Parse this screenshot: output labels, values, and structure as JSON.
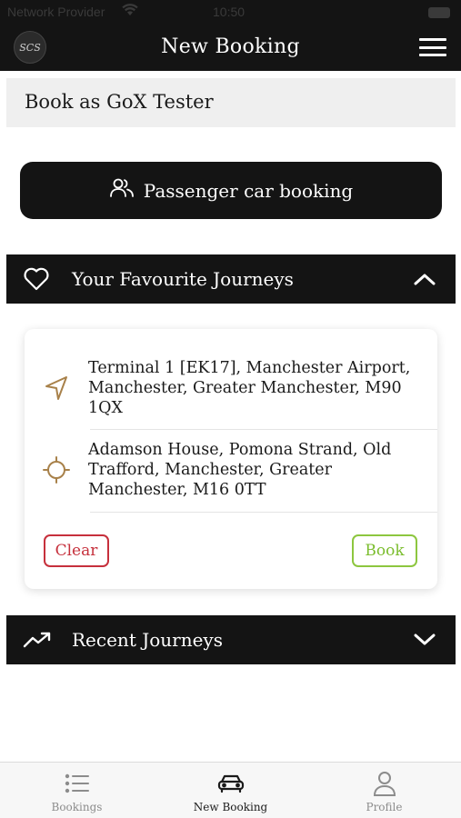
{
  "status_bar": {
    "carrier": "Network Provider",
    "time": "10:50"
  },
  "nav": {
    "logo_text": "SCS",
    "title": "New Booking",
    "menu_icon": "hamburger-icon"
  },
  "book_as": {
    "label": "Book as GoX Tester"
  },
  "passenger_button": {
    "icon": "users-icon",
    "label": "Passenger car booking"
  },
  "favourites": {
    "icon": "heart-icon",
    "label": "Your Favourite Journeys",
    "expanded": true,
    "journeys": [
      {
        "pickup": {
          "icon": "navigation-arrow-icon",
          "address": "Terminal 1 [EK17], Manchester Airport, Manchester, Greater Manchester, M90 1QX"
        },
        "dropoff": {
          "icon": "crosshair-icon",
          "address": "Adamson House, Pomona Strand, Old Trafford, Manchester, Greater Manchester, M16 0TT"
        },
        "clear_label": "Clear",
        "book_label": "Book"
      }
    ]
  },
  "recent": {
    "icon": "trending-up-icon",
    "label": "Recent Journeys",
    "expanded": false
  },
  "tabs": [
    {
      "label": "Bookings",
      "icon": "list-icon",
      "active": false
    },
    {
      "label": "New Booking",
      "icon": "car-icon",
      "active": true
    },
    {
      "label": "Profile",
      "icon": "user-icon",
      "active": false
    }
  ],
  "colors": {
    "header_bg": "#141414",
    "accent_gold": "#a8814a",
    "clear_red": "#c6303c",
    "book_green": "#8dc63f"
  }
}
